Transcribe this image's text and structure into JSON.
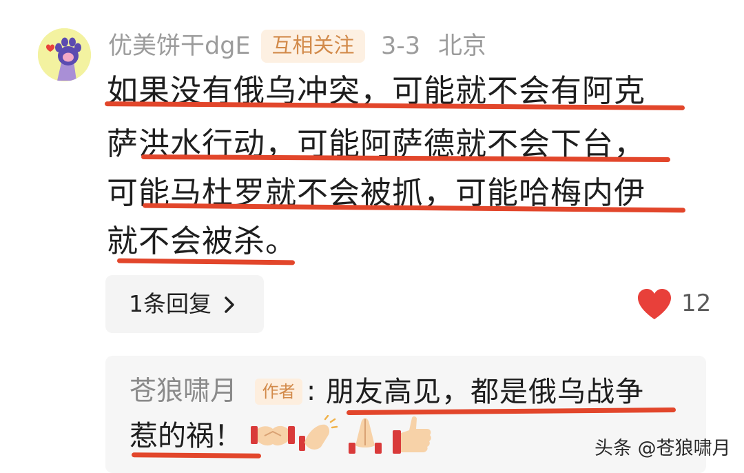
{
  "comment": {
    "author": "优美饼干dgE",
    "relation_badge": "互相关注",
    "date": "3-3",
    "location": "北京",
    "body_lines": [
      "如果没有俄乌冲突，可能就不会有阿克",
      "萨洪水行动，可能阿萨德就不会下台，",
      "可能马杜罗就不会被抓，可能哈梅内伊",
      "就不会被杀。"
    ],
    "reply_count_label": "1条回复",
    "like_count": "12"
  },
  "author_reply": {
    "name": "苍狼啸月",
    "author_badge": "作者",
    "colon": ":",
    "text_line_1": "朋友高见，都是俄乌战争",
    "text_line_2": "惹的祸！",
    "emojis": [
      "handshake-emoji",
      "clapping-hands-emoji",
      "folded-hands-emoji",
      "thumbs-up-emoji"
    ]
  },
  "watermark": "头条 @苍狼啸月",
  "colors": {
    "underline_marker": "#e2462b",
    "badge_bg": "#fdf0e2",
    "badge_text": "#d28a4a",
    "like_heart": "#e8403a",
    "muted_text": "#9c9c9c"
  },
  "icons": {
    "avatar": "paw-avatar-icon",
    "reply_chevron": "chevron-right-icon",
    "like": "heart-icon"
  }
}
